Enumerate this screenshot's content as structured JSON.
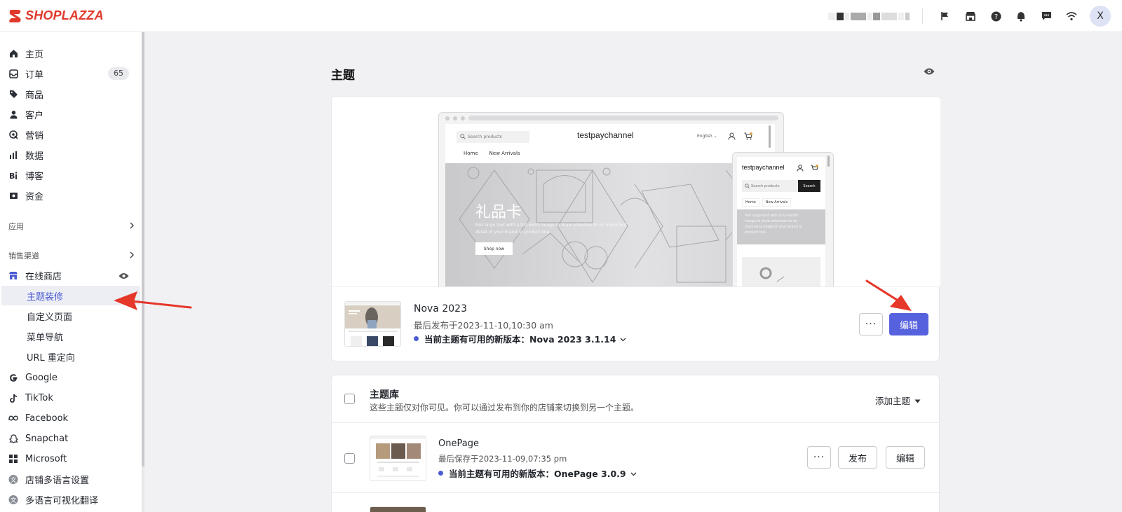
{
  "header": {
    "brand": "SHOPLAZZA",
    "avatar_initial": "X",
    "icons": [
      "flag-icon",
      "store-icon",
      "help-icon",
      "bell-icon",
      "chat-icon",
      "wifi-icon"
    ]
  },
  "sidebar": {
    "items": [
      {
        "label": "主页",
        "icon": "home-icon"
      },
      {
        "label": "订单",
        "icon": "inbox-icon",
        "badge": "65"
      },
      {
        "label": "商品",
        "icon": "tag-icon"
      },
      {
        "label": "客户",
        "icon": "person-icon"
      },
      {
        "label": "营销",
        "icon": "target-icon"
      },
      {
        "label": "数据",
        "icon": "bar-chart-icon"
      },
      {
        "label": "博客",
        "icon": "blog-icon"
      },
      {
        "label": "资金",
        "icon": "wallet-icon"
      }
    ],
    "apps_label": "应用",
    "channels_label": "销售渠道",
    "online_store": "在线商店",
    "online_store_subs": [
      "主题装修",
      "自定义页面",
      "菜单导航",
      "URL 重定向"
    ],
    "channels": [
      {
        "label": "Google",
        "icon": "google-icon"
      },
      {
        "label": "TikTok",
        "icon": "tiktok-icon"
      },
      {
        "label": "Facebook",
        "icon": "meta-icon"
      },
      {
        "label": "Snapchat",
        "icon": "snapchat-icon"
      },
      {
        "label": "Microsoft",
        "icon": "windows-icon"
      },
      {
        "label": "店铺多语言设置",
        "icon": "translate-icon"
      },
      {
        "label": "多语言可视化翻译",
        "icon": "translate-icon"
      }
    ]
  },
  "main": {
    "title": "主题",
    "preview": {
      "search_placeholder": "Search products",
      "store_name": "testpaychannel",
      "language": "English",
      "nav": [
        "Home",
        "New Arrivals"
      ],
      "hero_title": "礼品卡",
      "hero_text": "Pair large text with a full-width image to draw attention to an important detail of your brand or product line.",
      "hero_button": "Shop now",
      "mobile_search_button": "Search",
      "mobile_hero_text": "Pair large text with a full-width image to draw attention to an important detail of your brand or product line."
    },
    "current_theme": {
      "name": "Nova 2023",
      "published": "最后发布于2023-11-10,10:30 am",
      "update_notice": "当前主题有可用的新版本：Nova 2023 3.1.14",
      "more_label": "···",
      "edit_label": "编辑"
    },
    "library": {
      "title": "主题库",
      "subtitle": "这些主题仅对你可见。你可以通过发布到你的店铺来切换到另一个主题。",
      "add_label": "添加主题",
      "rows": [
        {
          "name": "OnePage",
          "saved": "最后保存于2023-11-09,07:35 pm",
          "update_notice": "当前主题有可用的新版本：OnePage 3.0.9",
          "more_label": "···",
          "publish_label": "发布",
          "edit_label": "编辑"
        }
      ]
    }
  },
  "colors": {
    "brand_red": "#e0392b",
    "primary": "#5661de",
    "active_text": "#4a5bd4",
    "annotation_arrow": "#e5372a"
  }
}
